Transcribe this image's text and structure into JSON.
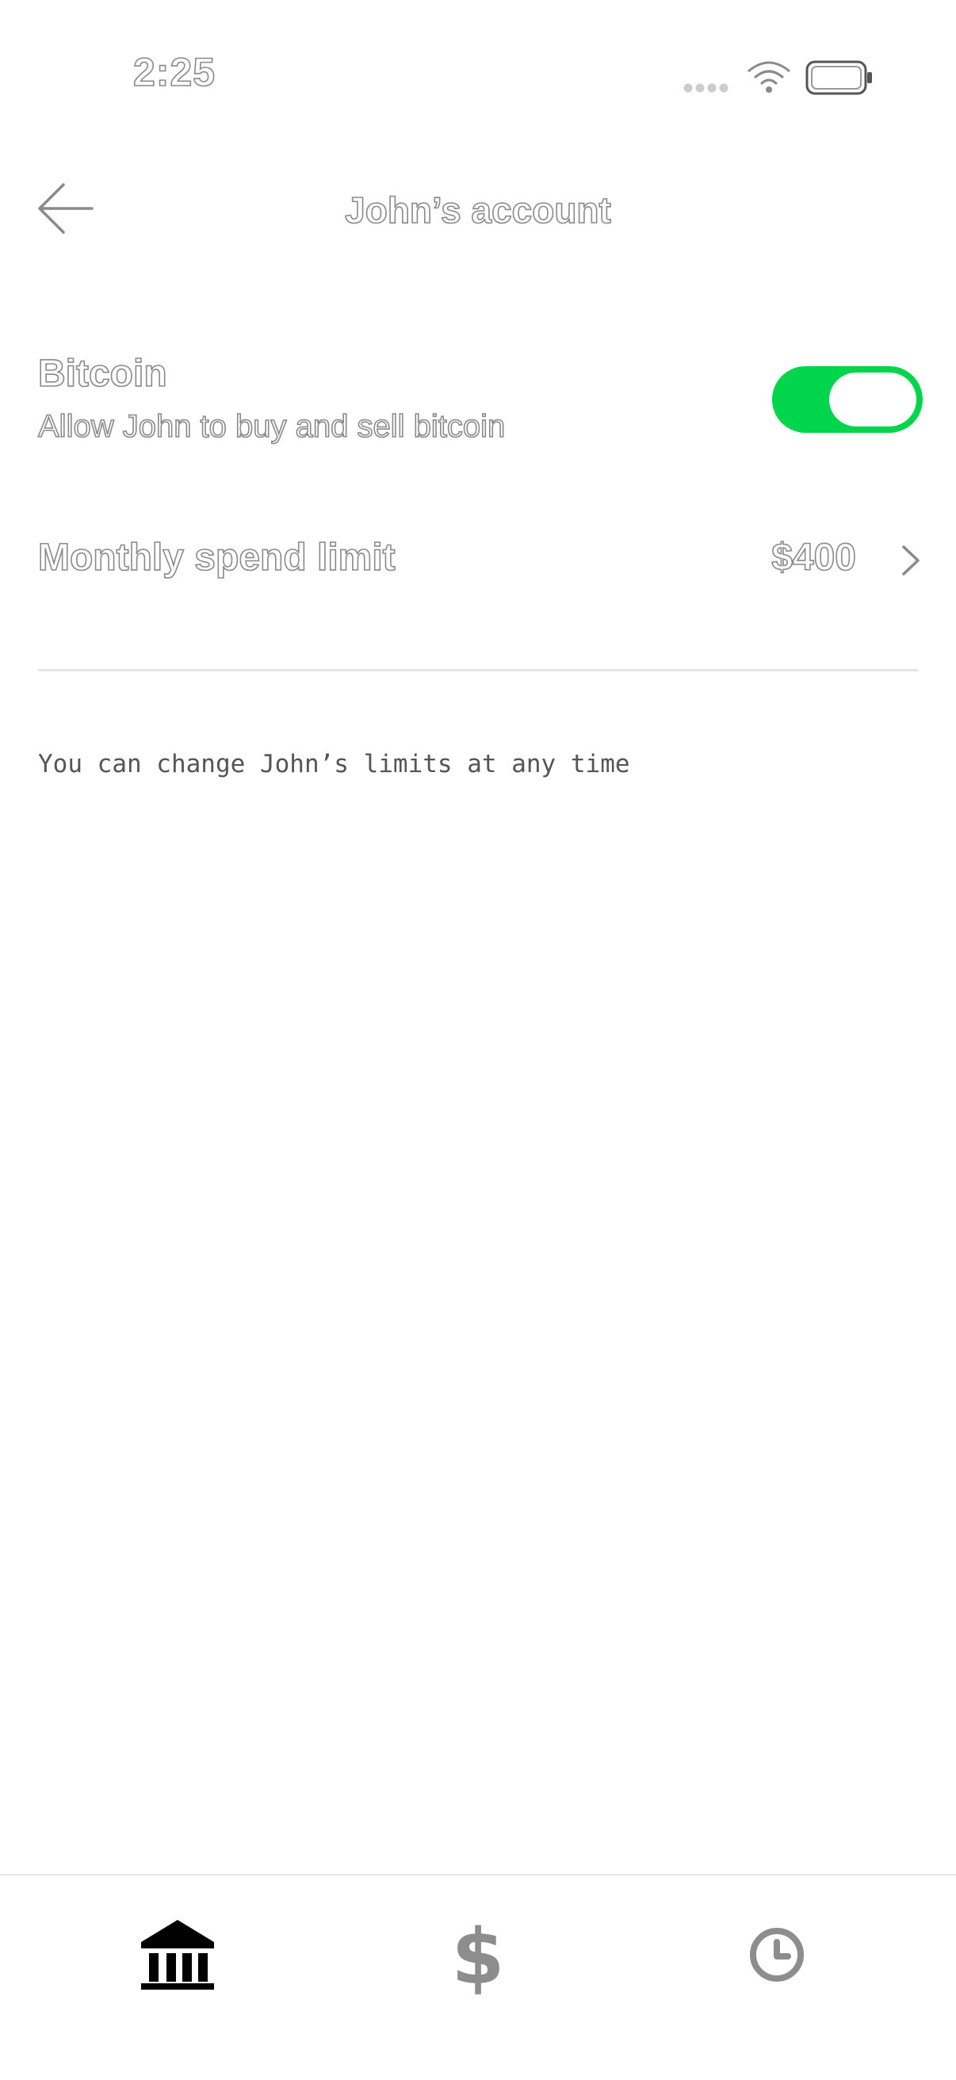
{
  "status_bar": {
    "time": "2:25",
    "icons": [
      "signal-icon",
      "wifi-icon",
      "battery-icon"
    ]
  },
  "header": {
    "back_icon": "arrow-left-icon",
    "title": "John’s account"
  },
  "bitcoin": {
    "title": "Bitcoin",
    "description": "Allow John to buy and sell bitcoin",
    "enabled": true
  },
  "monthly_limit": {
    "label": "Monthly spend limit",
    "value": "$400",
    "icon": "chevron-right-icon"
  },
  "footnote": "You can change John’s limits at any time",
  "tab_bar": {
    "tabs": [
      {
        "icon": "bank-icon",
        "active": true
      },
      {
        "icon": "dollar-icon",
        "active": false
      },
      {
        "icon": "clock-icon",
        "active": false
      }
    ]
  },
  "colors": {
    "toggle_on": "#00d54b",
    "active_tab": "#000000",
    "inactive_tab": "#8d8d8d",
    "divider": "#e5e5e5"
  }
}
